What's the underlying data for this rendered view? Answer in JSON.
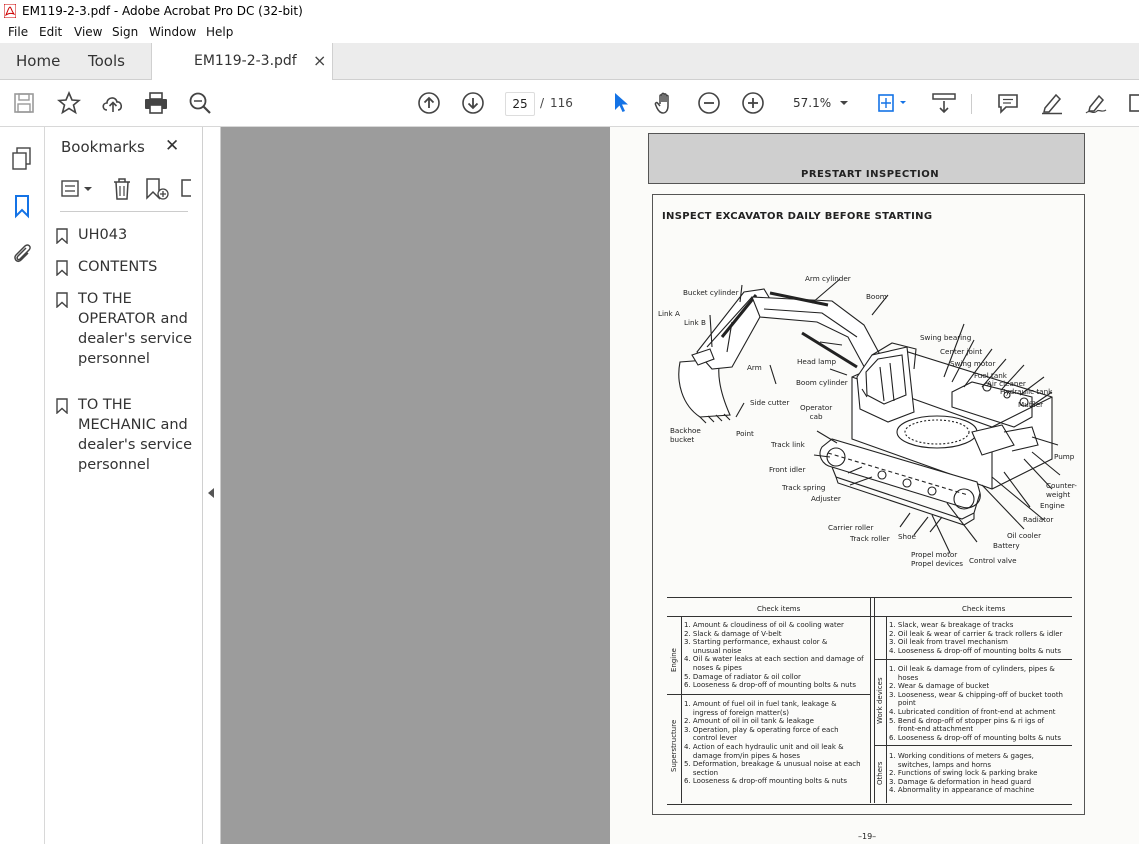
{
  "window": {
    "title": "EM119-2-3.pdf - Adobe Acrobat Pro DC (32-bit)"
  },
  "menu": [
    "File",
    "Edit",
    "View",
    "Sign",
    "Window",
    "Help"
  ],
  "tabs": {
    "home": "Home",
    "tools": "Tools",
    "document": "EM119-2-3.pdf",
    "close": "×"
  },
  "toolbar": {
    "current_page": "25",
    "page_sep": "/",
    "total_pages": "116",
    "zoom": "57.1%"
  },
  "bookmarks": {
    "title": "Bookmarks",
    "close": "✕",
    "items": [
      {
        "label": "UH043"
      },
      {
        "label": "CONTENTS"
      },
      {
        "label": "TO THE OPERATOR and dealer's service personnel"
      },
      {
        "label": "TO THE MECHANIC and dealer's service personnel"
      }
    ]
  },
  "pdf": {
    "header": "PRESTART INSPECTION",
    "heading": "INSPECT EXCAVATOR DAILY BEFORE STARTING",
    "labels": {
      "arm_cylinder": "Arm cylinder",
      "bucket_cylinder": "Bucket cylinder",
      "boom": "Boom",
      "link_a": "Link A",
      "link_b": "Link B",
      "swing_bearing": "Swing bearing",
      "center_joint": "Center joint",
      "swing_motor": "Swing motor",
      "fuel_tank": "Fuel tank",
      "air_cleaner": "Air cleaner",
      "hydraulic_tank": "Hydraulic tank",
      "muffler": "Muffler",
      "head_lamp": "Head lamp",
      "arm": "Arm",
      "boom_cylinder": "Boom cylinder",
      "side_cutter": "Side cutter",
      "operator_cab": "Operator\ncab",
      "backhoe_bucket": "Backhoe\nbucket",
      "point": "Point",
      "track_link": "Track link",
      "front_idler": "Front idler",
      "track_spring": "Track spring",
      "adjuster": "Adjuster",
      "pump": "Pump",
      "counterweight": "Counter-\nweight",
      "engine": "Engine",
      "radiator": "Radiator",
      "oil_cooler": "Oil cooler",
      "battery": "Battery",
      "carrier_roller": "Carrier roller",
      "track_roller": "Track roller",
      "shoe": "Shoe",
      "propel_motor": "Propel motor",
      "propel_devices": "Propel devices",
      "control_valve": "Control valve"
    },
    "table": {
      "left_header": "Check items",
      "right_header": "Check items",
      "engine_label": "Engine",
      "engine": "1. Amount & cloudiness of oil & cooling water\n2. Slack & damage of V-belt\n3. Starting performance, exhaust color &\n    unusual noise\n4. Oil & water leaks at each section and damage of\n    noses & pipes\n5. Damage of radiator & oil collor\n6. Looseness & drop-off of mounting bolts & nuts",
      "super_label": "Superstructure",
      "super": "1. Amount of fuel oil in fuel tank, leakage &\n    ingress of foreign matter(s)\n2. Amount of oil in oil tank & leakage\n3. Operation, play & operating force of each\n    control lever\n4. Action of each hydraulic unit and oil leak &\n    damage from/in pipes & hoses\n5. Deformation, breakage & unusual noise at each\n    section\n6. Looseness & drop-off mounting bolts & nuts",
      "under": "1. Slack, wear & breakage of tracks\n2. Oil leak & wear of carrier & track rollers & idler\n3. Oil leak from travel mechanism\n4. Looseness & drop-off of mounting bolts & nuts",
      "work_label": "Work devices",
      "work": "1. Oil leak & damage from of cylinders, pipes &\n    hoses\n2. Wear & damage of bucket\n3. Looseness, wear & chipping-off of bucket tooth\n    point\n4. Lubricated condition of front-end at achment\n5. Bend & drop-off of stopper pins & ri igs of\n    front-end attachment\n6. Looseness & drop-off of mounting bolts & nuts",
      "others_label": "Others",
      "others": "1. Working conditions of meters & gages,\n    switches, lamps and horns\n2. Functions of swing lock & parking brake\n3. Damage & deformation in head guard\n4. Abnormality in appearance of machine"
    },
    "page_number": "–19–"
  }
}
